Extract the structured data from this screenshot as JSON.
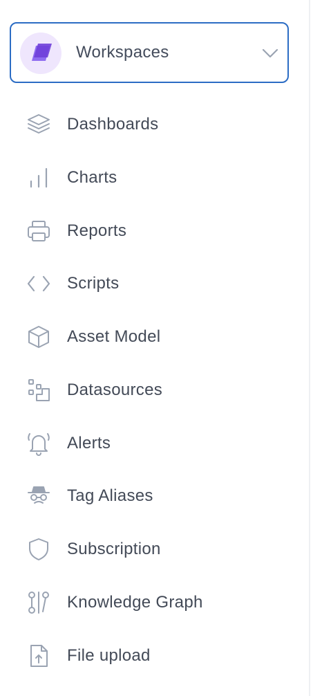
{
  "workspace": {
    "label": "Workspaces",
    "icon": "workspace-logo-icon",
    "chevron_icon": "chevron-down-icon",
    "logo_color": "#7b4fe0",
    "logo_bg": "#efe6fd",
    "border_color": "#2b6cc4"
  },
  "nav": {
    "items": [
      {
        "label": "Dashboards",
        "icon": "layers-icon"
      },
      {
        "label": "Charts",
        "icon": "bar-chart-icon"
      },
      {
        "label": "Reports",
        "icon": "printer-icon"
      },
      {
        "label": "Scripts",
        "icon": "code-icon"
      },
      {
        "label": "Asset Model",
        "icon": "cube-icon"
      },
      {
        "label": "Datasources",
        "icon": "datasource-icon"
      },
      {
        "label": "Alerts",
        "icon": "bell-icon"
      },
      {
        "label": "Tag Aliases",
        "icon": "incognito-icon"
      },
      {
        "label": "Subscription",
        "icon": "shield-icon"
      },
      {
        "label": "Knowledge Graph",
        "icon": "graph-icon"
      },
      {
        "label": "File upload",
        "icon": "file-upload-icon"
      }
    ]
  },
  "colors": {
    "icon": "#9aa3b2",
    "text": "#434a57"
  }
}
